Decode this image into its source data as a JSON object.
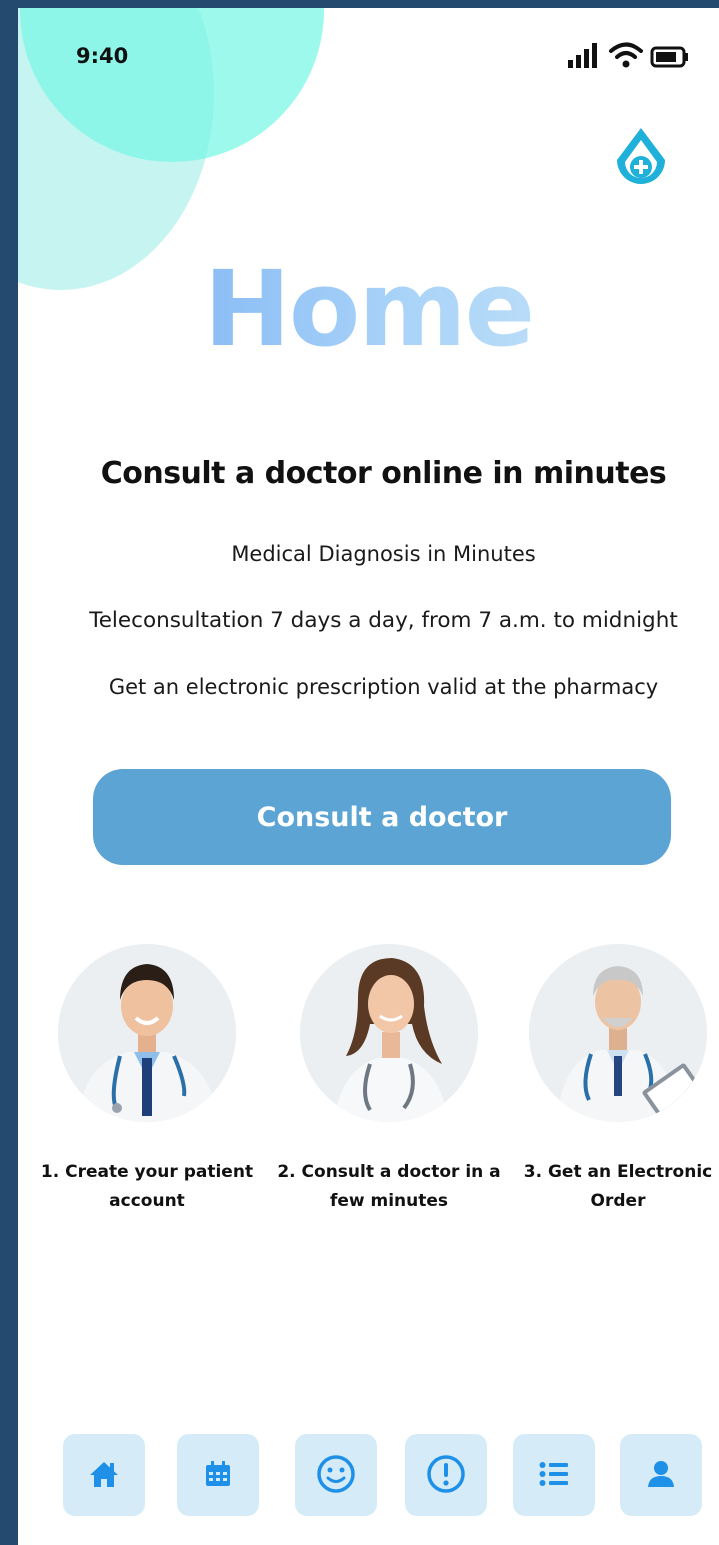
{
  "status": {
    "time": "9:40"
  },
  "page": {
    "title": "Home"
  },
  "hero": {
    "headline": "Consult a doctor online in minutes",
    "lines": [
      "Medical Diagnosis in Minutes",
      "Teleconsultation 7 days a day, from 7 a.m. to midnight",
      "Get an electronic prescription valid at the pharmacy"
    ],
    "cta_label": "Consult a doctor"
  },
  "steps": [
    {
      "label": "1. Create your patient account"
    },
    {
      "label": "2. Consult a doctor in a few minutes"
    },
    {
      "label": "3. Get an Electronic Order"
    }
  ],
  "nav": [
    "home-icon",
    "calendar-icon",
    "smiley-icon",
    "alert-icon",
    "list-icon",
    "user-icon"
  ],
  "colors": {
    "accent": "#5ba4d3",
    "nav_bg": "#d5ecf8",
    "nav_icon": "#1e90e8",
    "logo": "#1fb1d9",
    "blob": "#78f6e6"
  }
}
